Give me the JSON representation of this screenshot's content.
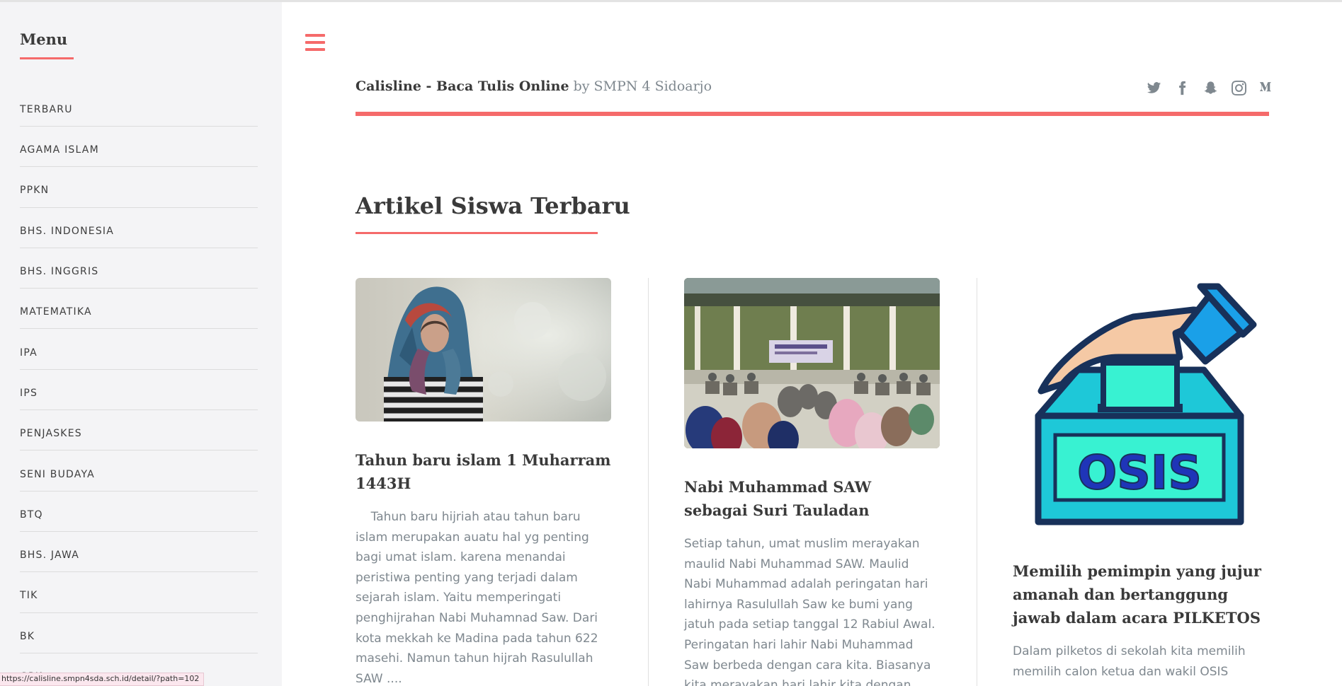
{
  "sidebar": {
    "title": "Menu",
    "items": [
      {
        "label": "TERBARU"
      },
      {
        "label": "AGAMA ISLAM"
      },
      {
        "label": "PPKN"
      },
      {
        "label": "BHS. INDONESIA"
      },
      {
        "label": "BHS. INGGRIS"
      },
      {
        "label": "MATEMATIKA"
      },
      {
        "label": "IPA"
      },
      {
        "label": "IPS"
      },
      {
        "label": "PENJASKES"
      },
      {
        "label": "SENI BUDAYA"
      },
      {
        "label": "BTQ"
      },
      {
        "label": "BHS. JAWA"
      },
      {
        "label": "TIK"
      },
      {
        "label": "BK"
      },
      {
        "label": "GPK"
      }
    ]
  },
  "status_bar": {
    "url": "https://calisline.smpn4sda.sch.id/detail/?path=102"
  },
  "header": {
    "brand": "Calisline - Baca Tulis Online",
    "byline": " by SMPN 4 Sidoarjo",
    "social_icons": [
      "twitter-icon",
      "facebook-icon",
      "snapchat-icon",
      "instagram-icon",
      "medium-icon"
    ],
    "accent_color": "#f56a6a"
  },
  "main": {
    "section_title": "Artikel Siswa Terbaru",
    "articles": [
      {
        "title": "Tahun baru islam 1 Muharram 1443H",
        "excerpt": "    Tahun baru hijriah atau tahun baru islam merupakan auatu hal yg penting bagi umat islam. karena menandai peristiwa penting yang terjadi dalam sejarah islam. Yaitu memperingati penghijrahan Nabi Muhamnad Saw. Dari kota mekkah ke Madina pada tahun 622 masehi. Namun tahun hijrah Rasulullah SAW ...."
      },
      {
        "title": "Nabi Muhammad SAW sebagai Suri Tauladan",
        "excerpt": "Setiap tahun, umat muslim merayakan maulid Nabi Muhammad SAW. Maulid Nabi Muhammad adalah peringatan hari lahirnya Rasulullah Saw ke bumi yang jatuh pada setiap tanggal 12 Rabiul Awal. Peringatan hari lahir Nabi Muhammad Saw berbeda dengan cara kita. Biasanya kita merayakan hari lahir kita dengan me..."
      },
      {
        "title": "Memilih pemimpin yang jujur amanah dan bertanggung jawab dalam acara PILKETOS",
        "excerpt": "Dalam pilketos di sekolah kita memilih memilih calon ketua dan wakil OSIS  secara",
        "image_text": "OSIS"
      }
    ]
  }
}
